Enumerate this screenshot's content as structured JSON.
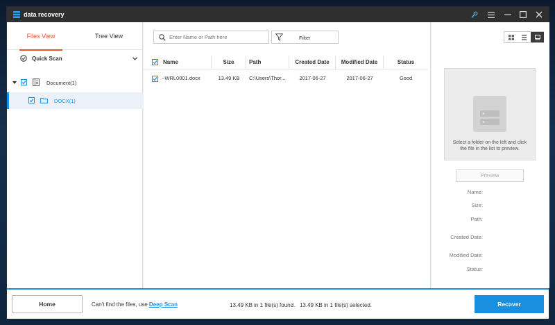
{
  "app": {
    "title": "data recovery"
  },
  "titlebar": {
    "icons": [
      "key-icon",
      "menu-icon",
      "minimize-icon",
      "maximize-icon",
      "close-icon"
    ]
  },
  "left": {
    "tabs": [
      {
        "label": "Files View"
      },
      {
        "label": "Tree View"
      }
    ],
    "quick_scan": "Quick Scan",
    "tree": [
      {
        "label": "Document(1)",
        "checked": true
      },
      {
        "label": "DOCX(1)",
        "checked": true
      }
    ]
  },
  "main": {
    "search_placeholder": "Enter Name or Path here",
    "filter_label": "Filter",
    "columns": [
      "Name",
      "Size",
      "Path",
      "Created Date",
      "Modified Date",
      "Status"
    ],
    "rows": [
      {
        "name": "~WRL0001.docx",
        "size": "13.49 KB",
        "path": "C:\\Users\\Thor...",
        "created": "2017-06-27",
        "modified": "2017-06-27",
        "status": "Good"
      }
    ]
  },
  "preview": {
    "message": "Select a folder on the left and click the file in the list to preview.",
    "button": "Preview",
    "props": [
      "Name:",
      "Size:",
      "Path:",
      "Created Date:",
      "Modified Date:",
      "Status:"
    ]
  },
  "bottom": {
    "home": "Home",
    "hint": "Can't find the files, use",
    "deep_scan": "Deep Scan",
    "status": "13.49 KB in 1 file(s) found.   13.49 KB in 1 file(s) selected.",
    "recover": "Recover"
  },
  "colors": {
    "accent": "#1a8fe0",
    "tab_active": "#e4572e",
    "titlebar": "#2f2f2f"
  }
}
